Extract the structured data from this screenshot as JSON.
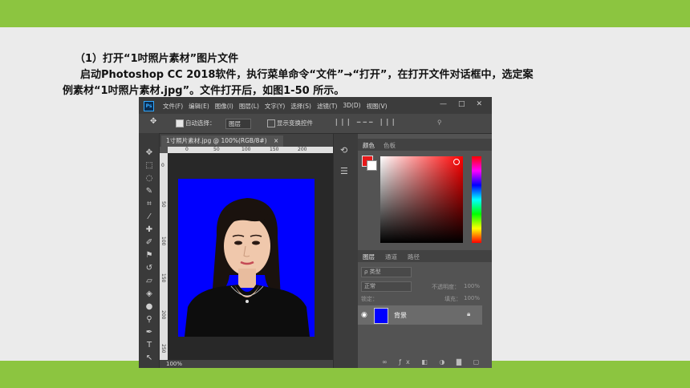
{
  "slide": {
    "step_title": "（1）打开“1吋照片素材”图片文件",
    "instruction_line1": "启动Photoshop CC 2018软件，执行菜单命令“文件”→“打开”，在打开文件对话框中，选定案",
    "instruction_line2": "例素材“1吋照片素材.jpg”。文件打开后，如图1-50 所示。"
  },
  "app": {
    "logo": "Ps",
    "menu": [
      "文件(F)",
      "编辑(E)",
      "图像(I)",
      "图层(L)",
      "文字(Y)",
      "选择(S)",
      "滤镜(T)",
      "3D(D)",
      "视图(V)"
    ],
    "window_controls": [
      "—",
      "□",
      "✕"
    ],
    "options": {
      "auto_select_label": "自动选择：",
      "auto_select_value": "图层",
      "show_transform_label": "显示变换控件"
    },
    "document_tab": "1寸照片素材.jpg @ 100%(RGB/8#)",
    "document_tab_close": "×",
    "ruler_h": [
      "0",
      "50",
      "100",
      "150",
      "200"
    ],
    "ruler_v": [
      "0",
      "50",
      "100",
      "150",
      "200",
      "250"
    ],
    "zoom": "100%",
    "panels": {
      "color_tabs": [
        "颜色",
        "色板"
      ],
      "layer_tabs": [
        "图层",
        "通道",
        "路径"
      ],
      "filter_label": "ρ 类型",
      "blend_mode": "正常",
      "opacity_label": "不透明度：",
      "opacity_value": "100%",
      "lock_label": "锁定：",
      "fill_label": "填充：",
      "fill_value": "100%",
      "layer_name": "背景",
      "foreground_color": "#e8191a",
      "background_color": "#ffffff"
    }
  },
  "colors": {
    "green_band": "#8cc540",
    "photo_background": "#0000ff"
  }
}
